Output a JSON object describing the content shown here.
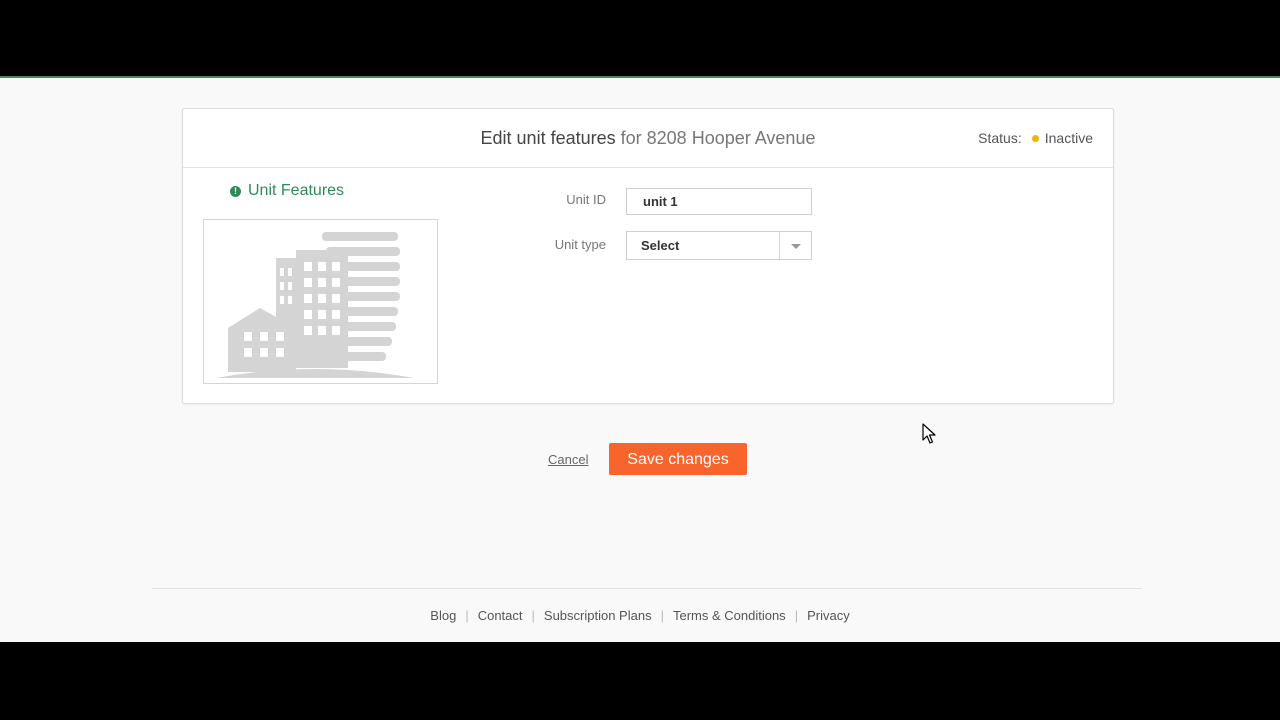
{
  "header": {
    "title_main": "Edit unit features",
    "title_sub": "for 8208 Hooper Avenue",
    "status_label": "Status:",
    "status_value": "Inactive",
    "status_color": "#f0b400"
  },
  "section": {
    "label": "Unit Features",
    "icon": "info-icon",
    "image_icon": "building-illustration"
  },
  "form": {
    "unit_id_label": "Unit ID",
    "unit_id_value": "unit 1",
    "unit_type_label": "Unit type",
    "unit_type_value": "Select"
  },
  "actions": {
    "cancel_label": "Cancel",
    "save_label": "Save changes",
    "save_color": "#f7652d"
  },
  "footer": {
    "links": [
      "Blog",
      "Contact",
      "Subscription Plans",
      "Terms & Conditions",
      "Privacy"
    ]
  }
}
